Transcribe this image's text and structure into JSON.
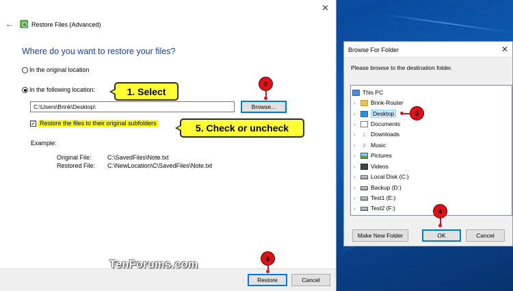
{
  "main_window": {
    "title": "Restore Files (Advanced)",
    "close_glyph": "✕",
    "back_glyph": "←",
    "heading": "Where do you want to restore your files?",
    "option_original": "In the original location",
    "option_following": "In the following location:",
    "selected_option": "following",
    "path_value": "C:\\Users\\Brink\\Desktop\\",
    "browse_label": "Browse...",
    "subfolders_label": "Restore the files to their original subfolders",
    "subfolders_checked": true,
    "example_label": "Example:",
    "original_file_label": "Original File:",
    "original_file_value": "C:\\SavedFiles\\Note.txt",
    "restored_file_label": "Restored File:",
    "restored_file_value": "C:\\NewLocation\\C\\SavedFiles\\Note.txt",
    "restore_label": "Restore",
    "cancel_label": "Cancel"
  },
  "annotations": {
    "callout_select": "1. Select",
    "callout_check": "5. Check or uncheck",
    "badge_2": "2",
    "badge_3": "3",
    "badge_4": "4",
    "badge_6": "6",
    "accent_color": "#d9131b",
    "callout_color": "#ffff33"
  },
  "watermark": "TenForums.com",
  "browse_dialog": {
    "title": "Browse For Folder",
    "close_glyph": "✕",
    "prompt": "Please browse to the destination folder.",
    "tree": [
      {
        "label": "This PC",
        "icon": "computer-icon",
        "expandable": false,
        "selected": false
      },
      {
        "label": "Brink-Router",
        "icon": "network-folder-icon",
        "expandable": true,
        "selected": false
      },
      {
        "label": "Desktop",
        "icon": "desktop-folder-icon",
        "expandable": true,
        "selected": true
      },
      {
        "label": "Documents",
        "icon": "documents-icon",
        "expandable": true,
        "selected": false
      },
      {
        "label": "Downloads",
        "icon": "downloads-icon",
        "expandable": true,
        "selected": false
      },
      {
        "label": "Music",
        "icon": "music-icon",
        "expandable": true,
        "selected": false
      },
      {
        "label": "Pictures",
        "icon": "pictures-icon",
        "expandable": true,
        "selected": false
      },
      {
        "label": "Videos",
        "icon": "videos-icon",
        "expandable": true,
        "selected": false
      },
      {
        "label": "Local Disk (C:)",
        "icon": "drive-icon",
        "expandable": true,
        "selected": false
      },
      {
        "label": "Backup (D:)",
        "icon": "drive-icon",
        "expandable": true,
        "selected": false
      },
      {
        "label": "Test1 (E:)",
        "icon": "drive-icon",
        "expandable": true,
        "selected": false
      },
      {
        "label": "Test2 (F:)",
        "icon": "drive-icon",
        "expandable": true,
        "selected": false
      }
    ],
    "make_new_folder_label": "Make New Folder",
    "ok_label": "OK",
    "cancel_label": "Cancel"
  }
}
